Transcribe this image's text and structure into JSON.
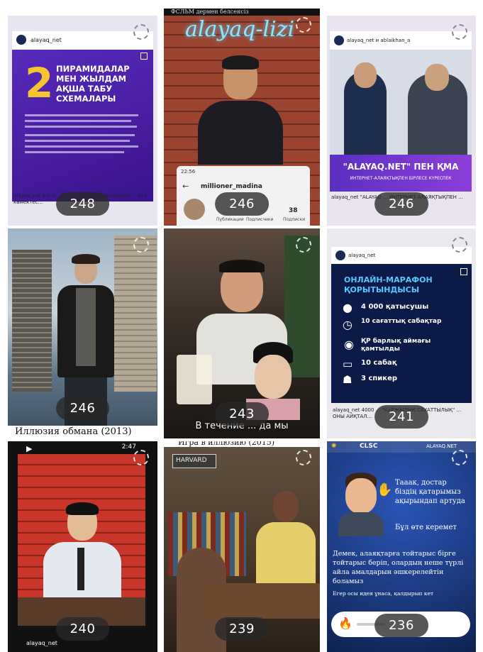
{
  "tiles": [
    {
      "count": "248",
      "handle": "alayaq_net",
      "number": "2",
      "headline": "ПИРАМИДАЛАР МЕН ЖЫЛДАМ АҚША ТАБУ СХЕМАЛАРЫ",
      "caption": "alayaq_net Бүгін ... жеке ақпараттарыңызды ... уга көмектес..."
    },
    {
      "count": "246",
      "top_text": "ФСЛЬМ дермен белсенсіз",
      "neon": "alayaq-lizi",
      "phone_time": "22:56",
      "phone_user": "millioner_madina",
      "phone_stat_1": "Публикации",
      "phone_stat_2": "Подписчики",
      "phone_stat_3_value": "38",
      "phone_stat_3_label": "Подписки"
    },
    {
      "count": "246",
      "handle": "alayaq_net и ablaikhan_a",
      "banner_title": "\"ALAYAQ.NET\" ПЕН ҚМА",
      "banner_sub": "ИНТЕРНЕТ-АЛАЯҚТЫҚПЕН БІРЛЕСЕ КҮРЕСПЕК",
      "caption": "alayaq_net \"ALAYAQ ... ИНТЕРНЕТ-АЛАЯҚТЫҚПЕН ..."
    },
    {
      "count": "246",
      "subtitle": "Иллюзия обмана (2013)"
    },
    {
      "count": "243",
      "subtitle": "В течение ... да мы"
    },
    {
      "count": "241",
      "handle": "alayaq_net",
      "title": "ОНЛАЙН-МАРАФОН ҚОРЫТЫНДЫСЫ",
      "stats": [
        "4 000 қатысушы",
        "10 сағаттық сабақтар",
        "ҚР барлық аймағы қамтылды",
        "10 сабақ",
        "3 спикер"
      ],
      "caption": "alayaq_net 4000 ... \"ҚАРЖЫЛЫҚ САУАТТЫЛЫҚ\" ... ОНЫ АЙҚТАЛ..."
    },
    {
      "count": "240",
      "time": "2:47",
      "handle": "alayaq_net"
    },
    {
      "count": "239",
      "top_text": "Игра в иллюзию (2015)",
      "sign": "HARVARD"
    },
    {
      "count": "236",
      "logo_1": "CLSC",
      "logo_2": "ALAYAQ.NET",
      "speech_1": "Тааак, достар біздің қатарымыз ақырындап артуда",
      "speech_2": "Бұл өте керемет",
      "body": "Демек, алаяқтарға тойтарыс бірге тойтарыс беріп, олардың неше түрлі айла амалдарын әшкерелейтін боламыз",
      "footer": "Егер осы идея ұнаса, қалдырып кет"
    }
  ],
  "colors": {
    "purple": "#4b1fa8",
    "purple_light": "#7a4cd8",
    "yellow": "#f4c531",
    "navy": "#0d1b4c",
    "blue_bg": "#1d3f8f"
  }
}
